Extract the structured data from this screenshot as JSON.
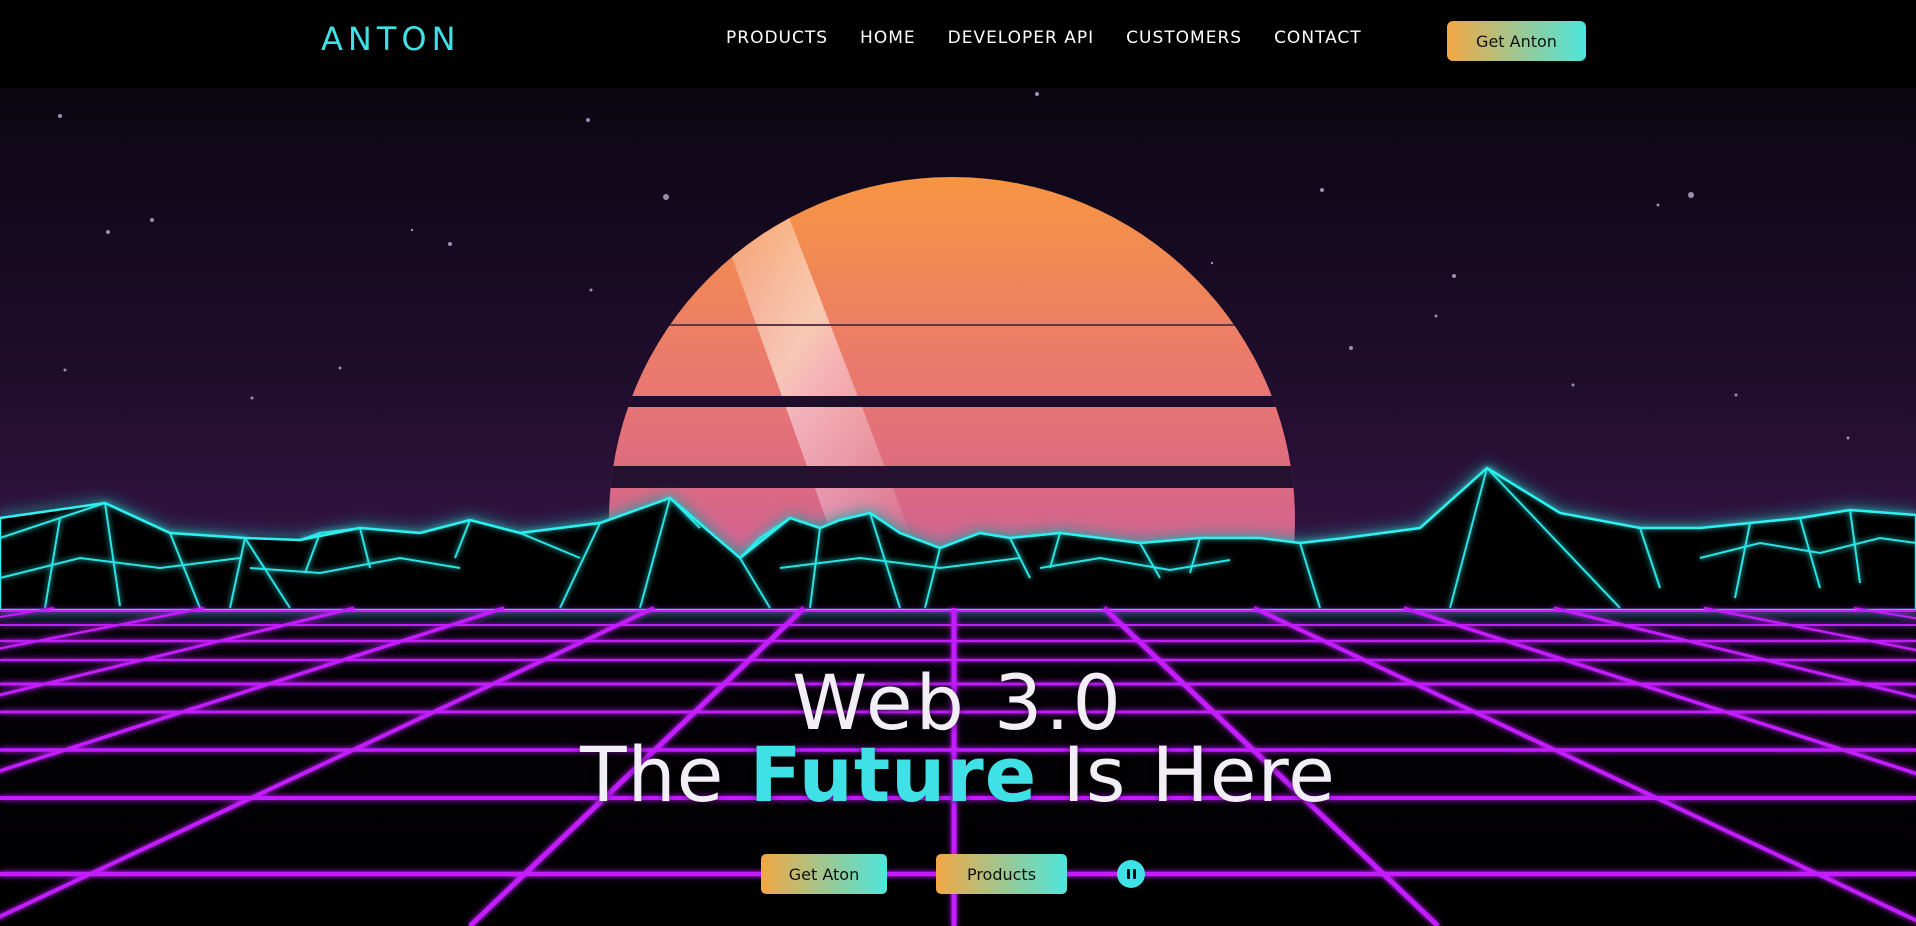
{
  "header": {
    "logo": "ANTON",
    "nav": [
      "PRODUCTS",
      "HOME",
      "DEVELOPER API",
      "CUSTOMERS",
      "CONTACT"
    ],
    "cta_label": "Get Anton"
  },
  "hero": {
    "line1": "Web 3.0",
    "line2_prefix": "The",
    "line2_accent": "Future",
    "line2_suffix": "Is Here",
    "primary_button": "Get Aton",
    "secondary_button": "Products",
    "pause_icon": "pause-icon"
  },
  "colors": {
    "accent": "#3fe0e6",
    "grid": "#c21cff",
    "sun_top": "#f9a13a",
    "sun_bottom": "#d9519c",
    "background": "#000000"
  }
}
